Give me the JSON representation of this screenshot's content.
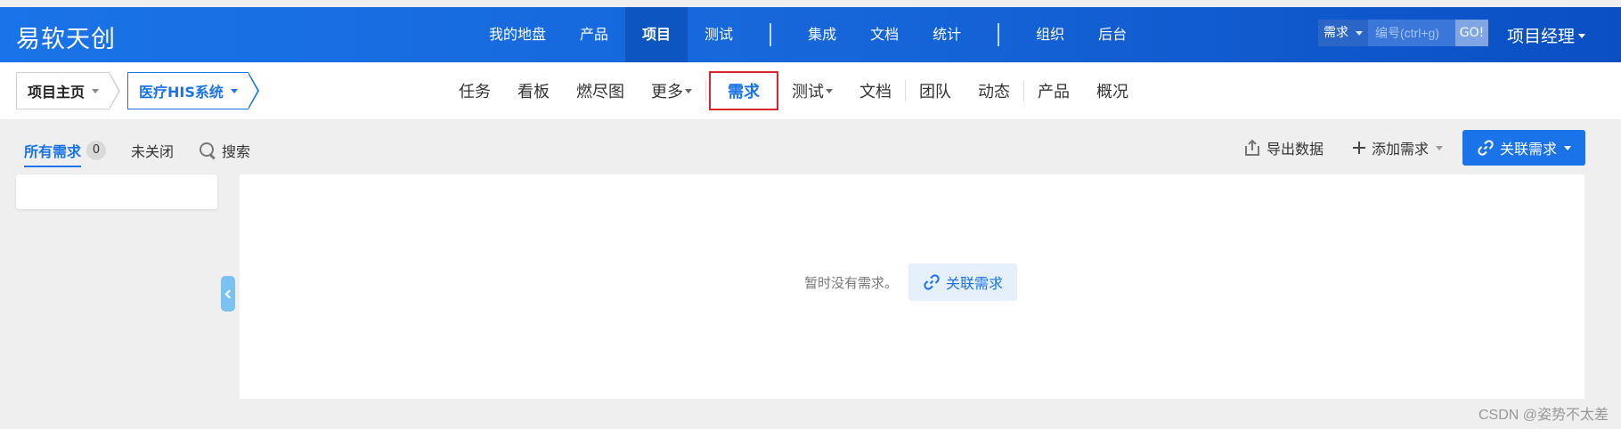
{
  "brand": "易软天创",
  "main_nav": [
    {
      "label": "我的地盘"
    },
    {
      "label": "产品"
    },
    {
      "label": "项目",
      "active": true
    },
    {
      "label": "测试"
    },
    {
      "label": "集成"
    },
    {
      "label": "文档"
    },
    {
      "label": "统计"
    },
    {
      "label": "组织"
    },
    {
      "label": "后台"
    }
  ],
  "quick_search": {
    "type": "需求",
    "placeholder": "编号(ctrl+g)",
    "go": "GO!"
  },
  "user": {
    "role": "项目经理"
  },
  "breadcrumb": {
    "home": "项目主页",
    "project": "医疗HIS系统"
  },
  "sub_nav": [
    {
      "label": "任务"
    },
    {
      "label": "看板"
    },
    {
      "label": "燃尽图"
    },
    {
      "label": "更多"
    },
    {
      "label": "需求",
      "active": true
    },
    {
      "label": "测试"
    },
    {
      "label": "文档"
    },
    {
      "label": "团队"
    },
    {
      "label": "动态"
    },
    {
      "label": "产品"
    },
    {
      "label": "概况"
    }
  ],
  "toolbar": {
    "all": "所有需求",
    "count": "0",
    "unclosed": "未关闭",
    "search": "搜索",
    "export": "导出数据",
    "add": "添加需求",
    "link": "关联需求"
  },
  "empty": {
    "text": "暂时没有需求。",
    "button": "关联需求"
  },
  "watermark": "CSDN @姿势不太差",
  "colors": {
    "primary": "#1a73e8",
    "highlight_border": "#d9252c",
    "page_bg": "#efefef"
  },
  "icons": [
    "search-icon",
    "export-icon",
    "plus-icon",
    "link-icon",
    "chevron-left-icon",
    "caret-down-icon"
  ]
}
